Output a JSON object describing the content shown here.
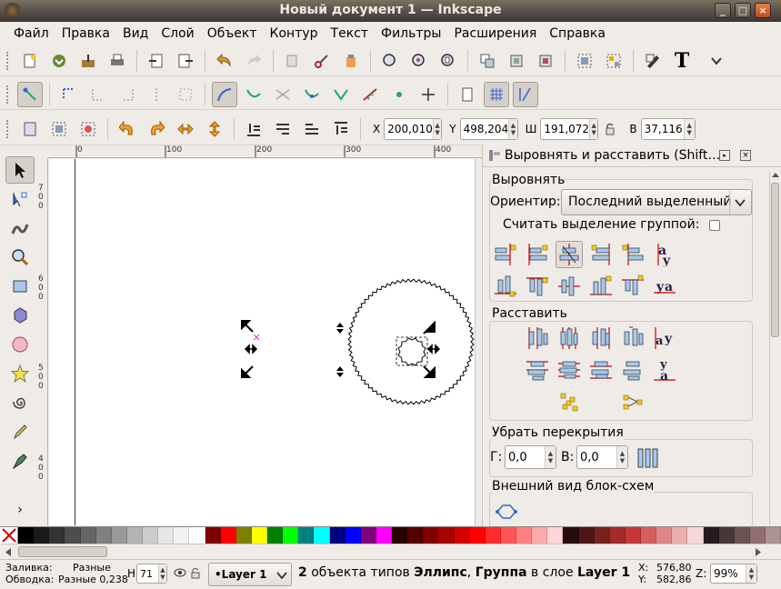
{
  "window": {
    "title": "Новый документ 1 — Inkscape",
    "min": "_",
    "max": "□",
    "close": "×"
  },
  "menu": [
    "Файл",
    "Правка",
    "Вид",
    "Слой",
    "Объект",
    "Контур",
    "Текст",
    "Фильтры",
    "Расширения",
    "Справка"
  ],
  "select_toolbar": {
    "x_label": "X",
    "x_value": "200,010",
    "y_label": "Y",
    "y_value": "498,204",
    "w_label": "Ш",
    "w_value": "191,072",
    "h_label": "В",
    "h_value": "37,116"
  },
  "rulers": {
    "top": [
      "0",
      "100",
      "200",
      "300",
      "400"
    ],
    "left": [
      "7",
      "0",
      "0",
      "6",
      "0",
      "0",
      "5",
      "0",
      "0",
      "4",
      "0",
      "0"
    ]
  },
  "dock": {
    "title": "Выровнять и расставить (Shift…",
    "align_section": "Выровнять",
    "relative_label": "Ориентир:",
    "relative_value": "Последний выделенный",
    "group_label": "Считать выделение группой:",
    "distribute_section": "Расставить",
    "overlap_section": "Убрать перекрытия",
    "h_label": "Г:",
    "h_value": "0,0",
    "v_label": "В:",
    "v_value": "0,0",
    "connector_section": "Внешний вид блок-схем"
  },
  "palette": [
    "#000000",
    "#1a1a1a",
    "#333333",
    "#4d4d4d",
    "#666666",
    "#808080",
    "#999999",
    "#b3b3b3",
    "#cccccc",
    "#e6e6e6",
    "#f2f2f2",
    "#ffffff",
    "#800000",
    "#ff0000",
    "#808000",
    "#ffff00",
    "#008000",
    "#00ff00",
    "#008080",
    "#00ffff",
    "#000080",
    "#0000ff",
    "#800080",
    "#ff00ff",
    "#2b0000",
    "#550000",
    "#800000",
    "#aa0000",
    "#d40000",
    "#ff0000",
    "#ff2a2a",
    "#ff5555",
    "#ff8080",
    "#ffaaaa",
    "#ffd5d5",
    "#280b0b",
    "#501616",
    "#782121",
    "#a02c2c",
    "#c83737",
    "#d35f5f",
    "#de8787",
    "#e9afaf",
    "#f4d7d7",
    "#241c1c",
    "#483737",
    "#6c5353",
    "#916f6f",
    "#ac9393"
  ],
  "status": {
    "fill_label": "Заливка:",
    "fill_value": "Разные",
    "stroke_label": "Обводка:",
    "stroke_value": "Разные 0,238",
    "h_label": "Н:",
    "opacity": "71",
    "layer": "•Layer 1",
    "message_count": "2",
    "message_a": " объекта типов ",
    "message_b": "Эллипс",
    "message_c": ", ",
    "message_d": "Группа",
    "message_e": " в слое ",
    "message_f": "Layer 1",
    "message_g": ". ",
    "x_label": "X:",
    "x": "576,80",
    "y_label": "Y:",
    "y": "582,86",
    "z_label": "Z:",
    "zoom": "99%"
  }
}
